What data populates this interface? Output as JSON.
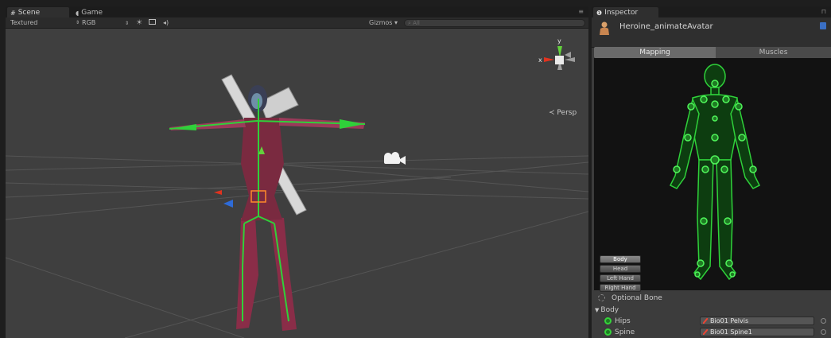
{
  "scene_panel": {
    "tabs": [
      {
        "label": "Scene"
      },
      {
        "label": "Game"
      }
    ],
    "toolbar": {
      "render_mode": "Textured",
      "color_mode": "RGB",
      "gizmos": "Gizmos ▾",
      "search_placeholder": "All"
    },
    "gizmo": {
      "y_label": "y",
      "x_label": "x",
      "projection": "Persp"
    }
  },
  "inspector": {
    "tab_label": "Inspector",
    "asset_name": "Heroine_animateAvatar",
    "segments": {
      "mapping": "Mapping",
      "muscles": "Muscles"
    },
    "part_buttons": [
      "Body",
      "Head",
      "Left Hand",
      "Right Hand"
    ],
    "optional_bone": "Optional Bone",
    "section": "Body",
    "bones": [
      {
        "name": "Hips",
        "mapped_to": "Bio01 Pelvis"
      },
      {
        "name": "Spine",
        "mapped_to": "Bio01 Spine1"
      }
    ],
    "colors": {
      "bone_green": "#34d33a",
      "panel_bg": "#3c3c3c",
      "avatar_bg": "#121212"
    }
  }
}
